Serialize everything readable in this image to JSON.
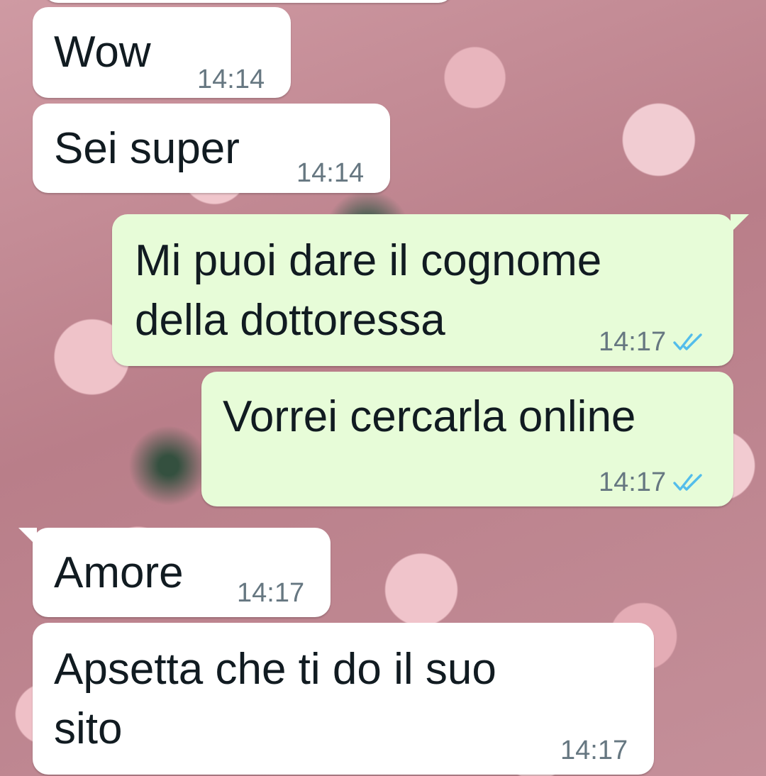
{
  "conversation": {
    "messages": [
      {
        "direction": "incoming",
        "text": "Wow",
        "time": "14:14"
      },
      {
        "direction": "incoming",
        "text": "Sei super",
        "time": "14:14"
      },
      {
        "direction": "outgoing",
        "text": "Mi puoi dare il cognome\ndella dottoressa",
        "time": "14:17",
        "status": "read"
      },
      {
        "direction": "outgoing",
        "text": "Vorrei cercarla online",
        "time": "14:17",
        "status": "read"
      },
      {
        "direction": "incoming",
        "text": "Amore",
        "time": "14:17"
      },
      {
        "direction": "incoming",
        "text": "Apsetta che ti do il suo\nsito",
        "time": "14:17"
      }
    ]
  },
  "theme": {
    "incoming_bubble": "#ffffff",
    "outgoing_bubble": "#e7fcd8",
    "text_color": "#111b21",
    "time_color": "#667781",
    "read_tick_color": "#53bdeb",
    "status_icon": "double-check-icon"
  }
}
